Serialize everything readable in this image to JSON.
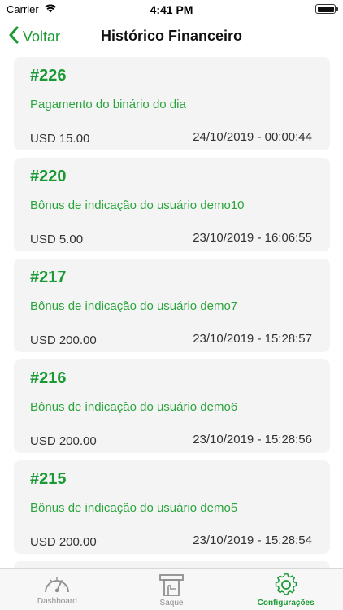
{
  "status": {
    "carrier": "Carrier",
    "time": "4:41 PM",
    "battery_level": 1.0
  },
  "nav": {
    "back_label": "Voltar",
    "title": "Histórico Financeiro"
  },
  "transactions": [
    {
      "id": "#226",
      "description": "Pagamento do binário do dia",
      "amount": "USD 15.00",
      "date": "24/10/2019 - 00:00:44"
    },
    {
      "id": "#220",
      "description": "Bônus de indicação do usuário demo10",
      "amount": "USD 5.00",
      "date": "23/10/2019 - 16:06:55"
    },
    {
      "id": "#217",
      "description": "Bônus de indicação do usuário demo7",
      "amount": "USD 200.00",
      "date": "23/10/2019 - 15:28:57"
    },
    {
      "id": "#216",
      "description": "Bônus de indicação do usuário demo6",
      "amount": "USD 200.00",
      "date": "23/10/2019 - 15:28:56"
    },
    {
      "id": "#215",
      "description": "Bônus de indicação do usuário demo5",
      "amount": "USD 200.00",
      "date": "23/10/2019 - 15:28:54"
    }
  ],
  "tabs": [
    {
      "label": "Dashboard",
      "icon": "speedometer-icon",
      "active": false
    },
    {
      "label": "Saque",
      "icon": "atm-withdraw-icon",
      "active": false
    },
    {
      "label": "Configurações",
      "icon": "gear-icon",
      "active": true
    }
  ],
  "colors": {
    "accent": "#1a9a33",
    "card_background": "#f4f4f4",
    "inactive_tab": "#8e8e8e"
  }
}
